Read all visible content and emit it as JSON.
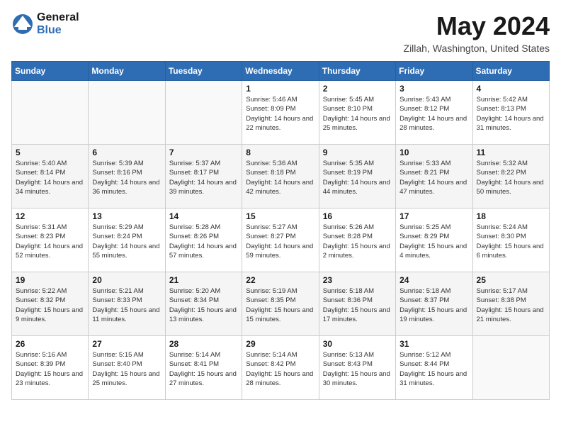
{
  "header": {
    "logo_general": "General",
    "logo_blue": "Blue",
    "month_title": "May 2024",
    "location": "Zillah, Washington, United States"
  },
  "days_of_week": [
    "Sunday",
    "Monday",
    "Tuesday",
    "Wednesday",
    "Thursday",
    "Friday",
    "Saturday"
  ],
  "weeks": [
    [
      {
        "day": "",
        "sunrise": "",
        "sunset": "",
        "daylight": ""
      },
      {
        "day": "",
        "sunrise": "",
        "sunset": "",
        "daylight": ""
      },
      {
        "day": "",
        "sunrise": "",
        "sunset": "",
        "daylight": ""
      },
      {
        "day": "1",
        "sunrise": "Sunrise: 5:46 AM",
        "sunset": "Sunset: 8:09 PM",
        "daylight": "Daylight: 14 hours and 22 minutes."
      },
      {
        "day": "2",
        "sunrise": "Sunrise: 5:45 AM",
        "sunset": "Sunset: 8:10 PM",
        "daylight": "Daylight: 14 hours and 25 minutes."
      },
      {
        "day": "3",
        "sunrise": "Sunrise: 5:43 AM",
        "sunset": "Sunset: 8:12 PM",
        "daylight": "Daylight: 14 hours and 28 minutes."
      },
      {
        "day": "4",
        "sunrise": "Sunrise: 5:42 AM",
        "sunset": "Sunset: 8:13 PM",
        "daylight": "Daylight: 14 hours and 31 minutes."
      }
    ],
    [
      {
        "day": "5",
        "sunrise": "Sunrise: 5:40 AM",
        "sunset": "Sunset: 8:14 PM",
        "daylight": "Daylight: 14 hours and 34 minutes."
      },
      {
        "day": "6",
        "sunrise": "Sunrise: 5:39 AM",
        "sunset": "Sunset: 8:16 PM",
        "daylight": "Daylight: 14 hours and 36 minutes."
      },
      {
        "day": "7",
        "sunrise": "Sunrise: 5:37 AM",
        "sunset": "Sunset: 8:17 PM",
        "daylight": "Daylight: 14 hours and 39 minutes."
      },
      {
        "day": "8",
        "sunrise": "Sunrise: 5:36 AM",
        "sunset": "Sunset: 8:18 PM",
        "daylight": "Daylight: 14 hours and 42 minutes."
      },
      {
        "day": "9",
        "sunrise": "Sunrise: 5:35 AM",
        "sunset": "Sunset: 8:19 PM",
        "daylight": "Daylight: 14 hours and 44 minutes."
      },
      {
        "day": "10",
        "sunrise": "Sunrise: 5:33 AM",
        "sunset": "Sunset: 8:21 PM",
        "daylight": "Daylight: 14 hours and 47 minutes."
      },
      {
        "day": "11",
        "sunrise": "Sunrise: 5:32 AM",
        "sunset": "Sunset: 8:22 PM",
        "daylight": "Daylight: 14 hours and 50 minutes."
      }
    ],
    [
      {
        "day": "12",
        "sunrise": "Sunrise: 5:31 AM",
        "sunset": "Sunset: 8:23 PM",
        "daylight": "Daylight: 14 hours and 52 minutes."
      },
      {
        "day": "13",
        "sunrise": "Sunrise: 5:29 AM",
        "sunset": "Sunset: 8:24 PM",
        "daylight": "Daylight: 14 hours and 55 minutes."
      },
      {
        "day": "14",
        "sunrise": "Sunrise: 5:28 AM",
        "sunset": "Sunset: 8:26 PM",
        "daylight": "Daylight: 14 hours and 57 minutes."
      },
      {
        "day": "15",
        "sunrise": "Sunrise: 5:27 AM",
        "sunset": "Sunset: 8:27 PM",
        "daylight": "Daylight: 14 hours and 59 minutes."
      },
      {
        "day": "16",
        "sunrise": "Sunrise: 5:26 AM",
        "sunset": "Sunset: 8:28 PM",
        "daylight": "Daylight: 15 hours and 2 minutes."
      },
      {
        "day": "17",
        "sunrise": "Sunrise: 5:25 AM",
        "sunset": "Sunset: 8:29 PM",
        "daylight": "Daylight: 15 hours and 4 minutes."
      },
      {
        "day": "18",
        "sunrise": "Sunrise: 5:24 AM",
        "sunset": "Sunset: 8:30 PM",
        "daylight": "Daylight: 15 hours and 6 minutes."
      }
    ],
    [
      {
        "day": "19",
        "sunrise": "Sunrise: 5:22 AM",
        "sunset": "Sunset: 8:32 PM",
        "daylight": "Daylight: 15 hours and 9 minutes."
      },
      {
        "day": "20",
        "sunrise": "Sunrise: 5:21 AM",
        "sunset": "Sunset: 8:33 PM",
        "daylight": "Daylight: 15 hours and 11 minutes."
      },
      {
        "day": "21",
        "sunrise": "Sunrise: 5:20 AM",
        "sunset": "Sunset: 8:34 PM",
        "daylight": "Daylight: 15 hours and 13 minutes."
      },
      {
        "day": "22",
        "sunrise": "Sunrise: 5:19 AM",
        "sunset": "Sunset: 8:35 PM",
        "daylight": "Daylight: 15 hours and 15 minutes."
      },
      {
        "day": "23",
        "sunrise": "Sunrise: 5:18 AM",
        "sunset": "Sunset: 8:36 PM",
        "daylight": "Daylight: 15 hours and 17 minutes."
      },
      {
        "day": "24",
        "sunrise": "Sunrise: 5:18 AM",
        "sunset": "Sunset: 8:37 PM",
        "daylight": "Daylight: 15 hours and 19 minutes."
      },
      {
        "day": "25",
        "sunrise": "Sunrise: 5:17 AM",
        "sunset": "Sunset: 8:38 PM",
        "daylight": "Daylight: 15 hours and 21 minutes."
      }
    ],
    [
      {
        "day": "26",
        "sunrise": "Sunrise: 5:16 AM",
        "sunset": "Sunset: 8:39 PM",
        "daylight": "Daylight: 15 hours and 23 minutes."
      },
      {
        "day": "27",
        "sunrise": "Sunrise: 5:15 AM",
        "sunset": "Sunset: 8:40 PM",
        "daylight": "Daylight: 15 hours and 25 minutes."
      },
      {
        "day": "28",
        "sunrise": "Sunrise: 5:14 AM",
        "sunset": "Sunset: 8:41 PM",
        "daylight": "Daylight: 15 hours and 27 minutes."
      },
      {
        "day": "29",
        "sunrise": "Sunrise: 5:14 AM",
        "sunset": "Sunset: 8:42 PM",
        "daylight": "Daylight: 15 hours and 28 minutes."
      },
      {
        "day": "30",
        "sunrise": "Sunrise: 5:13 AM",
        "sunset": "Sunset: 8:43 PM",
        "daylight": "Daylight: 15 hours and 30 minutes."
      },
      {
        "day": "31",
        "sunrise": "Sunrise: 5:12 AM",
        "sunset": "Sunset: 8:44 PM",
        "daylight": "Daylight: 15 hours and 31 minutes."
      },
      {
        "day": "",
        "sunrise": "",
        "sunset": "",
        "daylight": ""
      }
    ]
  ]
}
